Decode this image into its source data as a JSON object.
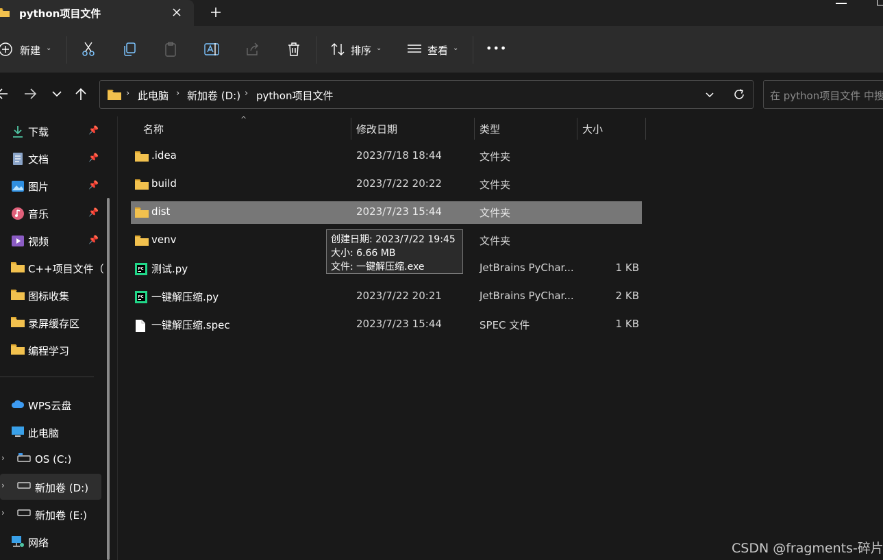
{
  "window": {
    "tab_title": "python项目文件",
    "new_tab": "+"
  },
  "toolbar": {
    "new_label": "新建",
    "sort_label": "排序",
    "view_label": "查看",
    "more_label": "•••"
  },
  "address": {
    "crumbs": [
      "此电脑",
      "新加卷 (D:)",
      "python项目文件"
    ]
  },
  "search": {
    "placeholder": "在 python项目文件 中搜索"
  },
  "sidebar": {
    "pinned": [
      {
        "label": "下载",
        "icon": "download-icon"
      },
      {
        "label": "文档",
        "icon": "document-icon"
      },
      {
        "label": "图片",
        "icon": "picture-icon"
      },
      {
        "label": "音乐",
        "icon": "music-icon"
      },
      {
        "label": "视频",
        "icon": "video-icon"
      }
    ],
    "folders": [
      "C++项目文件（",
      "图标收集",
      "录屏缓存区",
      "编程学习"
    ],
    "locations": [
      {
        "label": "WPS云盘",
        "icon": "cloud-icon"
      },
      {
        "label": "此电脑",
        "icon": "computer-icon"
      },
      {
        "label": "OS (C:)",
        "icon": "drive-icon"
      },
      {
        "label": "新加卷 (D:)",
        "icon": "drive-icon"
      },
      {
        "label": "新加卷 (E:)",
        "icon": "drive-icon"
      },
      {
        "label": "网络",
        "icon": "network-icon"
      }
    ]
  },
  "columns": {
    "name": "名称",
    "date": "修改日期",
    "type": "类型",
    "size": "大小"
  },
  "files": [
    {
      "name": ".idea",
      "date": "2023/7/18 18:44",
      "type": "文件夹",
      "size": "",
      "icon": "folder-icon"
    },
    {
      "name": "build",
      "date": "2023/7/22 20:22",
      "type": "文件夹",
      "size": "",
      "icon": "folder-icon"
    },
    {
      "name": "dist",
      "date": "2023/7/23 15:44",
      "type": "文件夹",
      "size": "",
      "icon": "folder-icon",
      "selected": true
    },
    {
      "name": "venv",
      "date": "",
      "type": "文件夹",
      "size": "",
      "icon": "folder-icon"
    },
    {
      "name": "测试.py",
      "date": "",
      "type": "JetBrains PyChar...",
      "size": "1 KB",
      "icon": "pycharm-file-icon"
    },
    {
      "name": "一键解压缩.py",
      "date": "2023/7/22 20:21",
      "type": "JetBrains PyChar...",
      "size": "2 KB",
      "icon": "pycharm-file-icon"
    },
    {
      "name": "一键解压缩.spec",
      "date": "2023/7/23 15:44",
      "type": "SPEC 文件",
      "size": "1 KB",
      "icon": "file-icon"
    }
  ],
  "tooltip": {
    "created": "创建日期: 2023/7/22 19:45",
    "size": "大小: 6.66 MB",
    "files": "文件: 一键解压缩.exe"
  },
  "watermark": "CSDN @fragments-碎片",
  "colors": {
    "background": "#191919",
    "toolbar": "#2c2c2c",
    "selection": "#777777",
    "folder": "#f2c14e"
  }
}
